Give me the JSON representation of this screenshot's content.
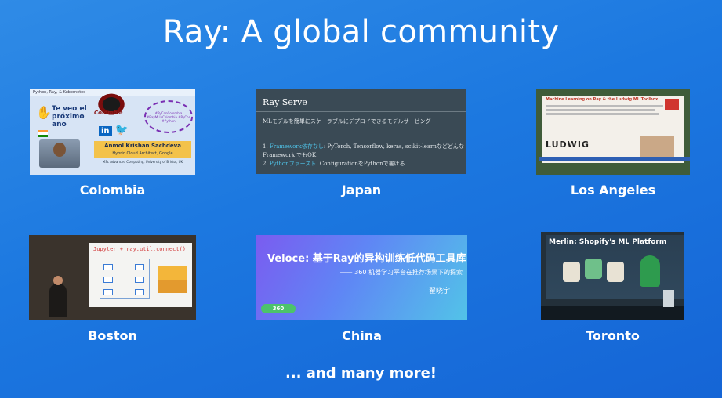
{
  "slide": {
    "title": "Ray: A global community",
    "footer": "... and many more!"
  },
  "tiles": [
    {
      "caption": "Colombia",
      "thumb": {
        "top_bar": "Python, Ray, & Kubernetes",
        "greeting": "Te veo el próximo año",
        "crest_label": "Colombia",
        "speaker_name": "Anmol Krishan Sachdeva",
        "speaker_role": "Hybrid Cloud Architect, Google",
        "speaker_detail": "MSc Advanced Computing, University of Bristol, UK",
        "social_labels": [
          "in",
          "🐦"
        ],
        "cloud_text": "#PyConColombia #RayMLInColombia #PyCon #Python"
      }
    },
    {
      "caption": "Japan",
      "thumb": {
        "heading": "Ray Serve",
        "intro": "MLモデルを簡単にスケーラブルにデプロイできるモデルサービング",
        "items": [
          {
            "num": "1.",
            "highlight": "Framework依存なし",
            "text": ": PyTorch, Tensorflow, keras, scikit-learnなどどんな Framework でもOK"
          },
          {
            "num": "2.",
            "highlight": "Pythonファースト",
            "text": ": ConfigurationをPythonで書ける"
          }
        ]
      }
    },
    {
      "caption": "Los Angeles",
      "thumb": {
        "heading": "Machine Learning on Ray & the Ludwig ML Toolbox",
        "logo": "LUDWIG"
      }
    },
    {
      "caption": "Boston",
      "thumb": {
        "code": "Jupyter + ray.util.connect()"
      }
    },
    {
      "caption": "China",
      "thumb": {
        "heading": "Veloce: 基于Ray的异构训练低代码工具库",
        "subheading": "—— 360 机器学习平台在推荐场景下的探索",
        "speaker": "翟晓宇",
        "badge": "360"
      }
    },
    {
      "caption": "Toronto",
      "thumb": {
        "heading": "Merlin: Shopify's ML Platform"
      }
    }
  ],
  "colors": {
    "background_top": "#2f8be6",
    "background_bottom": "#1565d6",
    "text": "#ffffff"
  }
}
